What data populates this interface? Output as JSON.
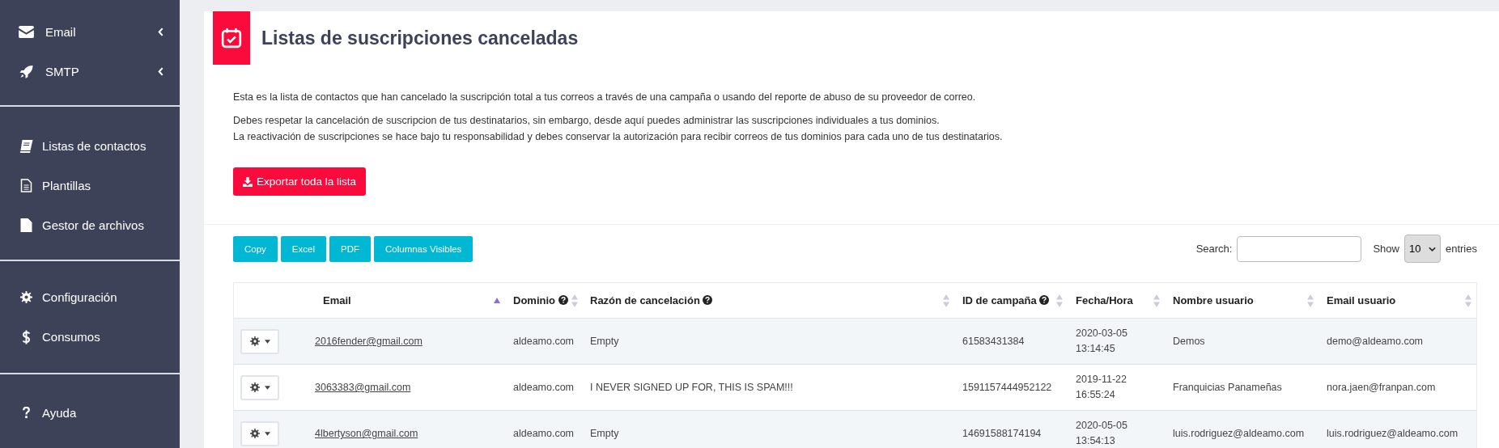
{
  "sidebar": {
    "groups": [
      {
        "items": [
          {
            "label": "Email",
            "expandable": true
          },
          {
            "label": "SMTP",
            "expandable": true
          }
        ]
      },
      {
        "items": [
          {
            "label": "Listas de contactos",
            "expandable": false
          },
          {
            "label": "Plantillas",
            "expandable": false
          },
          {
            "label": "Gestor de archivos",
            "expandable": false
          }
        ]
      },
      {
        "items": [
          {
            "label": "Configuración",
            "expandable": false
          },
          {
            "label": "Consumos",
            "expandable": false
          }
        ]
      },
      {
        "items": [
          {
            "label": "Ayuda",
            "expandable": false
          }
        ]
      }
    ]
  },
  "page": {
    "title": "Listas de suscripciones canceladas",
    "paragraphs": [
      [
        "Esta es la lista de contactos que han cancelado la suscripción total a tus correos a través de una campaña o usando del reporte de abuso de su proveedor de correo."
      ],
      [
        "Debes respetar la cancelación de suscripcion de tus destinatarios, sin embargo, desde aquí puedes administrar las suscripciones individuales a tus dominios.",
        "La reactivación de suscripciones se hace bajo tu responsabilidad y debes conservar la autorización para recibir correos de tus dominios para cada uno de tus destinatarios."
      ]
    ],
    "export_button": "Exportar toda la lista"
  },
  "toolbar": {
    "buttons": [
      "Copy",
      "Excel",
      "PDF",
      "Columnas Visibles"
    ],
    "search_label": "Search:",
    "show_label": "Show",
    "page_size": "10",
    "entries_label": "entries"
  },
  "table": {
    "columns": [
      {
        "label": "Email",
        "help": false,
        "sorted": true
      },
      {
        "label": "Dominio",
        "help": true,
        "sorted": false
      },
      {
        "label": "Razón de cancelación",
        "help": true,
        "sorted": false
      },
      {
        "label": "ID de campaña",
        "help": true,
        "sorted": false
      },
      {
        "label": "Fecha/Hora",
        "help": false,
        "sorted": false
      },
      {
        "label": "Nombre usuario",
        "help": false,
        "sorted": false
      },
      {
        "label": "Email usuario",
        "help": false,
        "sorted": false
      }
    ],
    "rows": [
      {
        "email": "2016fender@gmail.com",
        "domain": "aldeamo.com",
        "reason": "Empty",
        "campaign_id": "61583431384",
        "date": "2020-03-05",
        "time": "13:14:45",
        "user_name": "Demos",
        "user_email": "demo@aldeamo.com"
      },
      {
        "email": "3063383@gmail.com",
        "domain": "aldeamo.com",
        "reason": "I NEVER SIGNED UP FOR, THIS IS SPAM!!!",
        "campaign_id": "1591157444952122",
        "date": "2019-11-22",
        "time": "16:55:24",
        "user_name": "Franquicias Panameñas",
        "user_email": "nora.jaen@franpan.com"
      },
      {
        "email": "4lbertyson@gmail.com",
        "domain": "aldeamo.com",
        "reason": "Empty",
        "campaign_id": "14691588174194",
        "date": "2020-05-05",
        "time": "13:54:13",
        "user_name": "luis.rodriguez@aldeamo.com",
        "user_email": "luis.rodriguez@aldeamo.com"
      }
    ]
  }
}
